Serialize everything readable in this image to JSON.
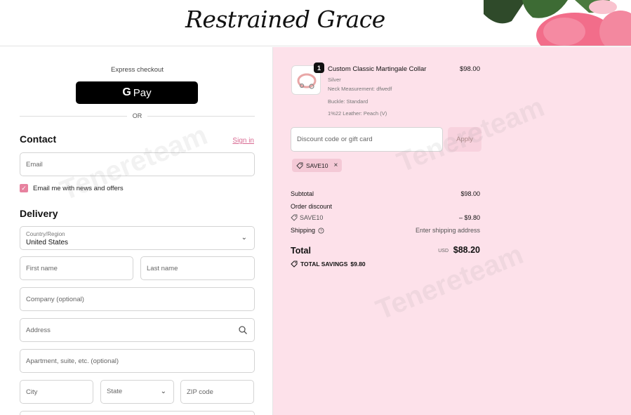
{
  "brand": {
    "logo_text": "Restrained Grace"
  },
  "checkout": {
    "express_label": "Express checkout",
    "gpay_label": "Pay",
    "gpay_g": "G",
    "or_label": "OR",
    "contact": {
      "title": "Contact",
      "sign_in": "Sign in",
      "email_placeholder": "Email",
      "news_checkbox_label": "Email me with news and offers",
      "news_checked": true
    },
    "delivery": {
      "title": "Delivery",
      "country_label": "Country/Region",
      "country_value": "United States",
      "first_name_placeholder": "First name",
      "last_name_placeholder": "Last name",
      "company_placeholder": "Company (optional)",
      "address_placeholder": "Address",
      "apartment_placeholder": "Apartment, suite, etc. (optional)",
      "city_placeholder": "City",
      "state_label": "State",
      "zip_placeholder": "ZIP code"
    }
  },
  "order": {
    "item": {
      "quantity": "1",
      "name": "Custom Classic Martingale Collar",
      "price": "$98.00",
      "variant": "Silver",
      "neck": "Neck Measurement: dfwedf",
      "buckle": "Buckle: Standard",
      "leather": "1%22 Leather: Peach (V)"
    },
    "discount_placeholder": "Discount code or gift card",
    "apply_label": "Apply",
    "applied_code": "SAVE10",
    "subtotal_label": "Subtotal",
    "subtotal_value": "$98.00",
    "order_discount_label": "Order discount",
    "discount_code": "SAVE10",
    "discount_value": "– $9.80",
    "shipping_label": "Shipping",
    "shipping_value": "Enter shipping address",
    "total_label": "Total",
    "currency": "USD",
    "total_value": "$88.20",
    "total_savings_label": "TOTAL SAVINGS",
    "total_savings_value": "$9.80"
  },
  "watermark": "Tenereteam",
  "colors": {
    "accent_pink": "#e7829f",
    "summary_bg": "#fde1ea",
    "link_pink": "#d86a92"
  }
}
